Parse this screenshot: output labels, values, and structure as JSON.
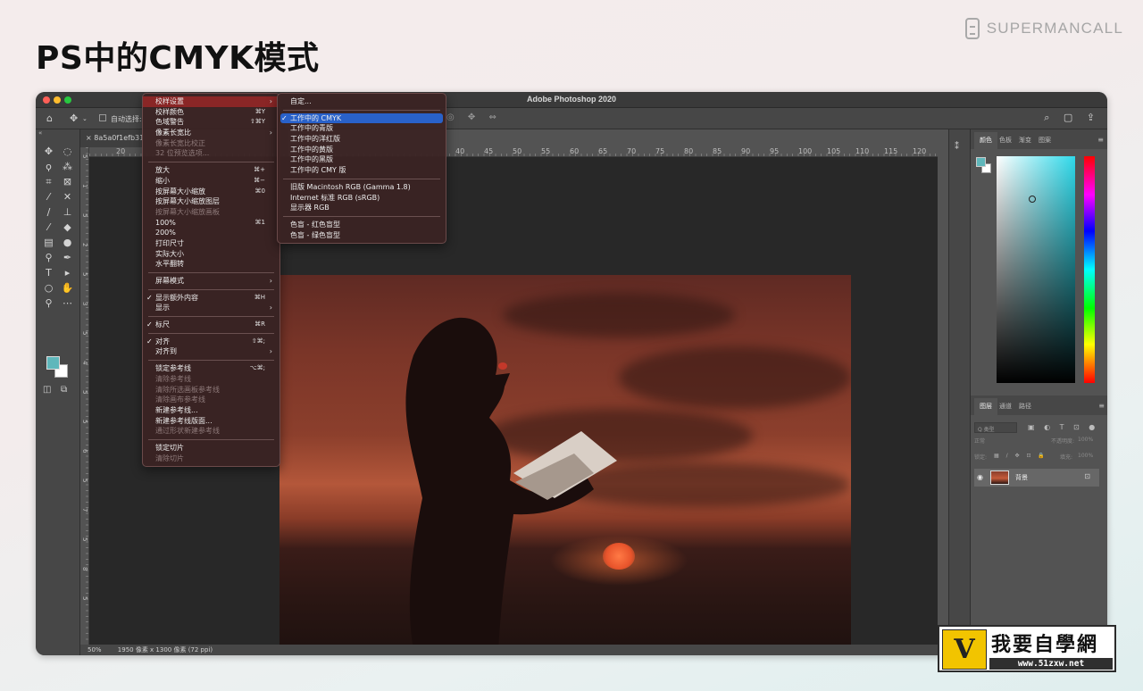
{
  "page": {
    "title": "PS中的CMYK模式",
    "brand": "SUPERMANCALL"
  },
  "window": {
    "title": "Adobe Photoshop 2020",
    "doc_tab": "8a5a0f1efb314",
    "options": {
      "auto_select": "自动选择:"
    }
  },
  "ruler": {
    "top_ticks": [
      "20",
      "40",
      "45",
      "50",
      "55",
      "60",
      "65",
      "70",
      "75",
      "80",
      "85",
      "90",
      "95",
      "100",
      "105",
      "110",
      "115",
      "120"
    ],
    "left_ticks": [
      "5",
      "1",
      "5",
      "2",
      "5",
      "3",
      "5",
      "4",
      "5",
      "5",
      "6",
      "5",
      "7",
      "5",
      "8",
      "5"
    ]
  },
  "status": {
    "zoom": "50%",
    "doc_info": "1950 像素 x 1300 像素 (72 ppi)"
  },
  "view_menu": {
    "items": [
      {
        "label": "校样设置",
        "arrow": true,
        "highlighted": true
      },
      {
        "label": "校样颜色",
        "shortcut": "⌘Y"
      },
      {
        "label": "色域警告",
        "shortcut": "⇧⌘Y"
      },
      {
        "label": "像素长宽比",
        "arrow": true
      },
      {
        "label": "像素长宽比校正",
        "disabled": true
      },
      {
        "label": "32 位预览选项...",
        "disabled": true
      },
      {
        "sep": true
      },
      {
        "label": "放大",
        "shortcut": "⌘+"
      },
      {
        "label": "缩小",
        "shortcut": "⌘−"
      },
      {
        "label": "按屏幕大小缩放",
        "shortcut": "⌘0"
      },
      {
        "label": "按屏幕大小缩放图层"
      },
      {
        "label": "按屏幕大小缩放画板",
        "disabled": true
      },
      {
        "label": "100%",
        "shortcut": "⌘1"
      },
      {
        "label": "200%"
      },
      {
        "label": "打印尺寸"
      },
      {
        "label": "实际大小"
      },
      {
        "label": "水平翻转"
      },
      {
        "sep": true
      },
      {
        "label": "屏幕模式",
        "arrow": true
      },
      {
        "sep": true
      },
      {
        "label": "显示额外内容",
        "shortcut": "⌘H",
        "checked": true
      },
      {
        "label": "显示",
        "arrow": true
      },
      {
        "sep": true
      },
      {
        "label": "标尺",
        "shortcut": "⌘R",
        "checked": true
      },
      {
        "sep": true
      },
      {
        "label": "对齐",
        "shortcut": "⇧⌘;",
        "checked": true
      },
      {
        "label": "对齐到",
        "arrow": true
      },
      {
        "sep": true
      },
      {
        "label": "锁定参考线",
        "shortcut": "⌥⌘;"
      },
      {
        "label": "清除参考线",
        "disabled": true
      },
      {
        "label": "清除所选画板参考线",
        "disabled": true
      },
      {
        "label": "清除画布参考线",
        "disabled": true
      },
      {
        "label": "新建参考线..."
      },
      {
        "label": "新建参考线版面..."
      },
      {
        "label": "通过形状新建参考线",
        "disabled": true
      },
      {
        "sep": true
      },
      {
        "label": "锁定切片"
      },
      {
        "label": "清除切片",
        "disabled": true
      }
    ]
  },
  "proof_submenu": {
    "items": [
      {
        "label": "自定..."
      },
      {
        "sep": true
      },
      {
        "label": "工作中的 CMYK",
        "checked": true,
        "selected": true
      },
      {
        "label": "工作中的青版"
      },
      {
        "label": "工作中的洋红版"
      },
      {
        "label": "工作中的黄版"
      },
      {
        "label": "工作中的黑版"
      },
      {
        "label": "工作中的 CMY 版"
      },
      {
        "sep": true
      },
      {
        "label": "旧版 Macintosh RGB (Gamma 1.8)"
      },
      {
        "label": "Internet 标准 RGB (sRGB)"
      },
      {
        "label": "显示器 RGB"
      },
      {
        "sep": true
      },
      {
        "label": "色盲 - 红色盲型"
      },
      {
        "label": "色盲 - 绿色盲型"
      }
    ]
  },
  "color_panel": {
    "tabs": [
      "颜色",
      "色板",
      "渐变",
      "图案"
    ],
    "foreground": "#5fb7bb",
    "background": "#ffffff",
    "hue": "#2fd9ea"
  },
  "layers_panel": {
    "tabs": [
      "图层",
      "通道",
      "路径"
    ],
    "filter_kind": "Q 类型",
    "blend_mode": "正常",
    "opacity_label": "不透明度:",
    "opacity": "100%",
    "lock_label": "锁定:",
    "fill_label": "填充:",
    "fill": "100%",
    "layer_name": "背景"
  },
  "watermark": {
    "text": "我要自學網",
    "url": "www.51zxw.net"
  }
}
